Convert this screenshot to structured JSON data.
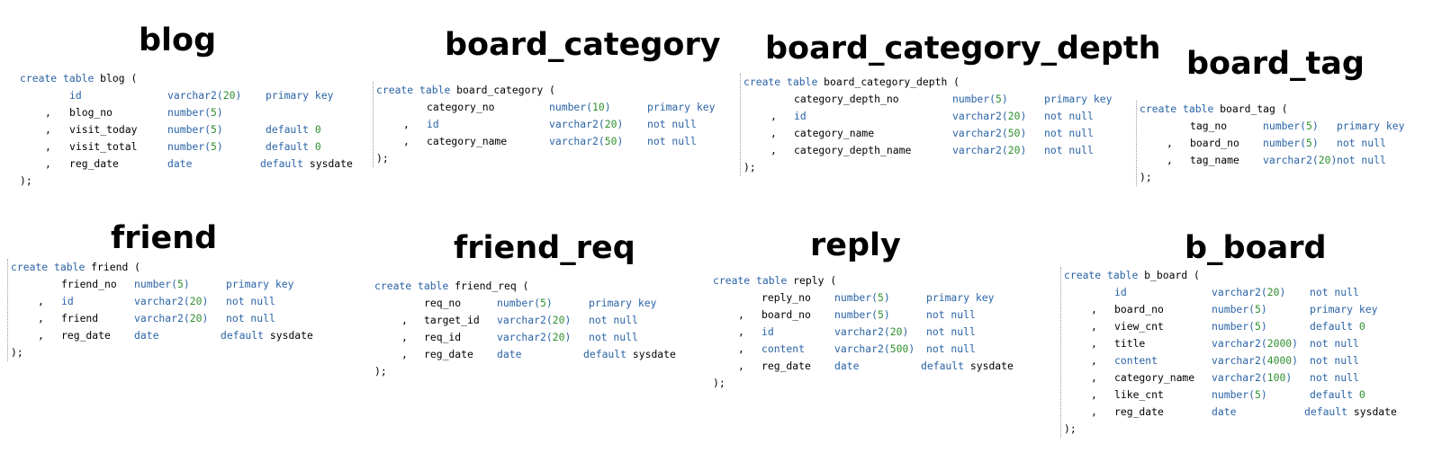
{
  "tables": [
    {
      "title": "blog",
      "header": "blog (",
      "rows": [
        {
          "comma": "",
          "col": "id",
          "type": "varchar2",
          "size": "20",
          "constraint": "primary key",
          "value": ""
        },
        {
          "comma": ",",
          "col": "blog_no",
          "type": "number",
          "size": "5",
          "constraint": "",
          "value": ""
        },
        {
          "comma": ",",
          "col": "visit_today",
          "type": "number",
          "size": "5",
          "constraint": "default",
          "value": "0"
        },
        {
          "comma": ",",
          "col": "visit_total",
          "type": "number",
          "size": "5",
          "constraint": "default",
          "value": "0"
        },
        {
          "comma": ",",
          "col": "reg_date",
          "type": "date",
          "size": "",
          "constraint": "default",
          "value": "sysdate"
        }
      ],
      "closing": ");"
    },
    {
      "title": "board_category",
      "header": "board_category (",
      "rows": [
        {
          "comma": "",
          "col": "category_no",
          "type": "number",
          "size": "10",
          "constraint": "primary key",
          "value": ""
        },
        {
          "comma": ",",
          "col": "id",
          "type": "varchar2",
          "size": "20",
          "constraint": "not null",
          "value": ""
        },
        {
          "comma": ",",
          "col": "category_name",
          "type": "varchar2",
          "size": "50",
          "constraint": "not null",
          "value": ""
        }
      ],
      "closing": ");"
    },
    {
      "title": "board_category_depth",
      "header": "board_category_depth (",
      "rows": [
        {
          "comma": "",
          "col": "category_depth_no",
          "type": "number",
          "size": "5",
          "constraint": "primary key",
          "value": ""
        },
        {
          "comma": ",",
          "col": "id",
          "type": "varchar2",
          "size": "20",
          "constraint": "not null",
          "value": ""
        },
        {
          "comma": ",",
          "col": "category_name",
          "type": "varchar2",
          "size": "50",
          "constraint": "not null",
          "value": ""
        },
        {
          "comma": ",",
          "col": "category_depth_name",
          "type": "varchar2",
          "size": "20",
          "constraint": "not null",
          "value": ""
        }
      ],
      "closing": ");"
    },
    {
      "title": "board_tag",
      "header": "board_tag (",
      "rows": [
        {
          "comma": "",
          "col": "tag_no",
          "type": "number",
          "size": "5",
          "constraint": "primary key",
          "value": ""
        },
        {
          "comma": ",",
          "col": "board_no",
          "type": "number",
          "size": "5",
          "constraint": "not null",
          "value": ""
        },
        {
          "comma": ",",
          "col": "tag_name",
          "type": "varchar2",
          "size": "20",
          "constraint": "not null",
          "value": ""
        }
      ],
      "closing": ");"
    },
    {
      "title": "friend",
      "header": "friend (",
      "rows": [
        {
          "comma": "",
          "col": "friend_no",
          "type": "number",
          "size": "5",
          "constraint": "primary key",
          "value": ""
        },
        {
          "comma": ",",
          "col": "id",
          "type": "varchar2",
          "size": "20",
          "constraint": "not null",
          "value": ""
        },
        {
          "comma": ",",
          "col": "friend",
          "type": "varchar2",
          "size": "20",
          "constraint": "not null",
          "value": ""
        },
        {
          "comma": ",",
          "col": "reg_date",
          "type": "date",
          "size": "",
          "constraint": "default",
          "value": "sysdate"
        }
      ],
      "closing": ");"
    },
    {
      "title": "friend_req",
      "header": "friend_req (",
      "rows": [
        {
          "comma": "",
          "col": "req_no",
          "type": "number",
          "size": "5",
          "constraint": "primary key",
          "value": ""
        },
        {
          "comma": ",",
          "col": "target_id",
          "type": "varchar2",
          "size": "20",
          "constraint": "not null",
          "value": ""
        },
        {
          "comma": ",",
          "col": "req_id",
          "type": "varchar2",
          "size": "20",
          "constraint": "not null",
          "value": ""
        },
        {
          "comma": ",",
          "col": "reg_date",
          "type": "date",
          "size": "",
          "constraint": "default",
          "value": "sysdate"
        }
      ],
      "closing": ");"
    },
    {
      "title": "reply",
      "header": "reply (",
      "rows": [
        {
          "comma": "",
          "col": "reply_no",
          "type": "number",
          "size": "5",
          "constraint": "primary key",
          "value": ""
        },
        {
          "comma": ",",
          "col": "board_no",
          "type": "number",
          "size": "5",
          "constraint": "not null",
          "value": ""
        },
        {
          "comma": ",",
          "col": "id",
          "type": "varchar2",
          "size": "20",
          "constraint": "not null",
          "value": ""
        },
        {
          "comma": ",",
          "col": "content",
          "type": "varchar2",
          "size": "500",
          "constraint": "not null",
          "value": ""
        },
        {
          "comma": ",",
          "col": "reg_date",
          "type": "date",
          "size": "",
          "constraint": "default",
          "value": "sysdate"
        }
      ],
      "closing": ");"
    },
    {
      "title": "b_board",
      "header": "b_board (",
      "rows": [
        {
          "comma": "",
          "col": "id",
          "type": "varchar2",
          "size": "20",
          "constraint": "not null",
          "value": ""
        },
        {
          "comma": ",",
          "col": "board_no",
          "type": "number",
          "size": "5",
          "constraint": "primary key",
          "value": ""
        },
        {
          "comma": ",",
          "col": "view_cnt",
          "type": "number",
          "size": "5",
          "constraint": "default",
          "value": "0"
        },
        {
          "comma": ",",
          "col": "title",
          "type": "varchar2",
          "size": "2000",
          "constraint": "not null",
          "value": ""
        },
        {
          "comma": ",",
          "col": "content",
          "type": "varchar2",
          "size": "4000",
          "constraint": "not null",
          "value": ""
        },
        {
          "comma": ",",
          "col": "category_name",
          "type": "varchar2",
          "size": "100",
          "constraint": "not null",
          "value": ""
        },
        {
          "comma": ",",
          "col": "like_cnt",
          "type": "number",
          "size": "5",
          "constraint": "default",
          "value": "0"
        },
        {
          "comma": ",",
          "col": "reg_date",
          "type": "date",
          "size": "",
          "constraint": "default",
          "value": "sysdate"
        }
      ],
      "closing": ");"
    }
  ],
  "keywords": {
    "create": "create",
    "table": "table"
  },
  "colors": {
    "keyword": "#2a63a6",
    "number": "#2f8f2f",
    "text": "#000000"
  }
}
